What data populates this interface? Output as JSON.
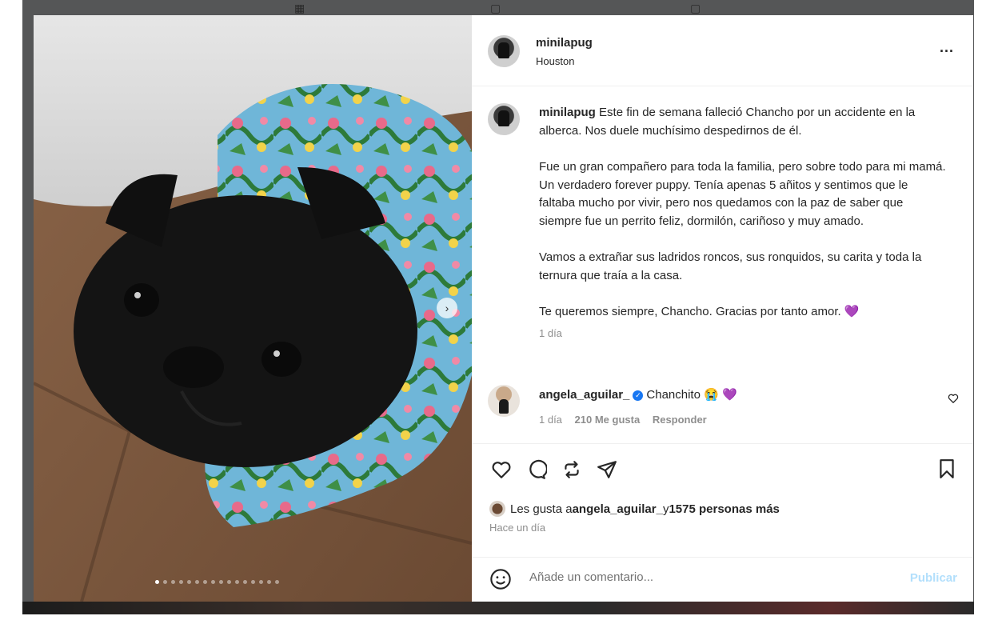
{
  "post": {
    "username": "minilapug",
    "location": "Houston",
    "more_label": "...",
    "caption": {
      "username": "minilapug",
      "paragraphs": [
        "Este fin de semana falleció Chancho por un accidente en la alberca. Nos duele muchísimo despedirnos de él.",
        "Fue un gran compañero para toda la familia, pero sobre todo para mi mamá. Un verdadero forever puppy. Tenía apenas 5 añitos y sentimos que le faltaba mucho por vivir, pero nos quedamos con la paz de saber que siempre fue un perrito feliz, dormilón, cariñoso y muy amado.",
        "Vamos a extrañar sus ladridos roncos, sus ronquidos, su carita y toda la ternura que traía a la casa.",
        "Te queremos siempre, Chancho. Gracias por tanto amor. 💜"
      ],
      "time": "1 día"
    },
    "comment": {
      "username": "angela_aguilar_",
      "text": "Chanchito 😭 💜",
      "time": "1 día",
      "likes": "210 Me gusta",
      "reply_label": "Responder"
    },
    "likes": {
      "prefix": "Les gusta a ",
      "user": "angela_aguilar_",
      "middle": " y ",
      "others": "1575 personas más"
    },
    "posted_ago": "Hace un día",
    "add_comment": {
      "placeholder": "Añade un comentario...",
      "publish_label": "Publicar"
    },
    "carousel": {
      "slide_count": 16,
      "active_index": 0
    }
  },
  "colors": {
    "text": "#262626",
    "muted": "#8e8e8e",
    "publish": "#b2dffc",
    "verified": "#1877f2"
  }
}
